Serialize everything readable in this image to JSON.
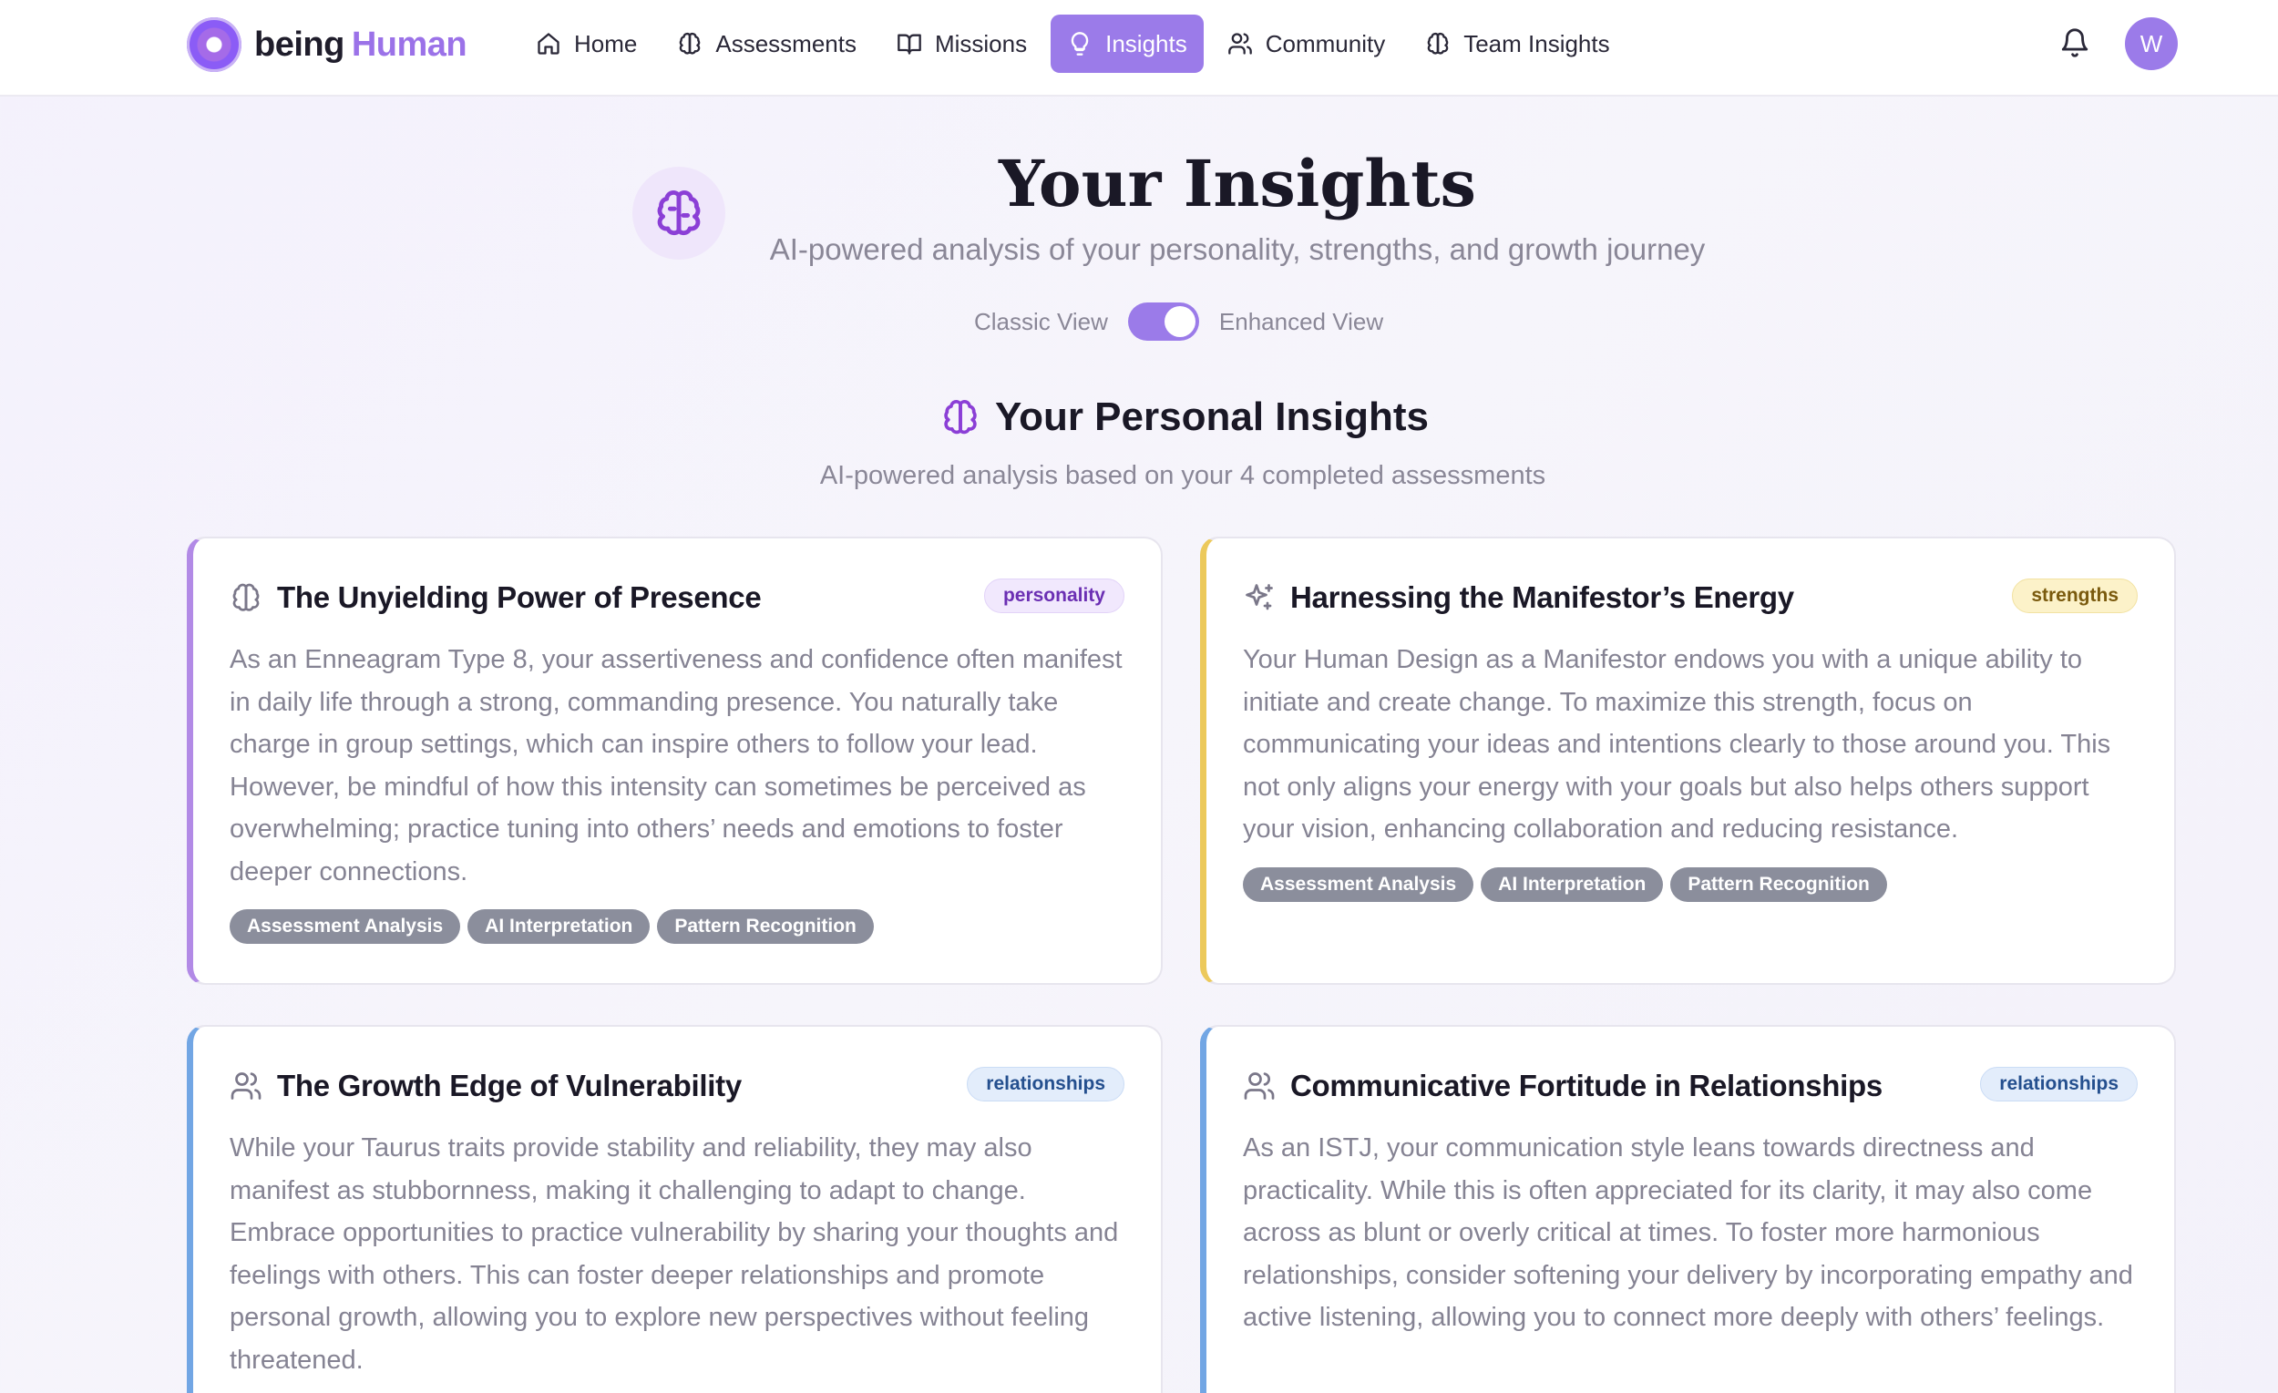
{
  "brand": {
    "word1": "being",
    "word2": "Human"
  },
  "nav": {
    "items": [
      {
        "label": "Home",
        "icon": "home-icon"
      },
      {
        "label": "Assessments",
        "icon": "brain-icon"
      },
      {
        "label": "Missions",
        "icon": "book-icon"
      },
      {
        "label": "Insights",
        "icon": "lightbulb-icon",
        "active": true
      },
      {
        "label": "Community",
        "icon": "users-icon"
      },
      {
        "label": "Team Insights",
        "icon": "brain-icon"
      }
    ],
    "avatar_initial": "W"
  },
  "hero": {
    "title": "Your Insights",
    "subtitle": "AI-powered analysis of your personality, strengths, and growth journey",
    "toggle_left": "Classic View",
    "toggle_right": "Enhanced View",
    "toggle_on": true
  },
  "section": {
    "title": "Your Personal Insights",
    "subtitle": "AI-powered analysis based on your 4 completed assessments"
  },
  "cards": [
    {
      "title": "The Unyielding Power of Presence",
      "category": "personality",
      "icon": "brain-icon",
      "body": "As an Enneagram Type 8, your assertiveness and confidence often manifest in daily life through a strong, commanding presence. You naturally take charge in group settings, which can inspire others to follow your lead. However, be mindful of how this intensity can sometimes be perceived as overwhelming; practice tuning into others’ needs and emotions to foster deeper connections.",
      "tags": [
        "Assessment Analysis",
        "AI Interpretation",
        "Pattern Recognition"
      ]
    },
    {
      "title": "Harnessing the Manifestor’s Energy",
      "category": "strengths",
      "icon": "sparkles-icon",
      "body": "Your Human Design as a Manifestor endows you with a unique ability to initiate and create change. To maximize this strength, focus on communicating your ideas and intentions clearly to those around you. This not only aligns your energy with your goals but also helps others support your vision, enhancing collaboration and reducing resistance.",
      "tags": [
        "Assessment Analysis",
        "AI Interpretation",
        "Pattern Recognition"
      ]
    },
    {
      "title": "The Growth Edge of Vulnerability",
      "category": "relationships",
      "icon": "users-icon",
      "body": "While your Taurus traits provide stability and reliability, they may also manifest as stubbornness, making it challenging to adapt to change. Embrace opportunities to practice vulnerability by sharing your thoughts and feelings with others. This can foster deeper relationships and promote personal growth, allowing you to explore new perspectives without feeling threatened.",
      "tags": []
    },
    {
      "title": "Communicative Fortitude in Relationships",
      "category": "relationships",
      "icon": "users-icon",
      "body": "As an ISTJ, your communication style leans towards directness and practicality. While this is often appreciated for its clarity, it may also come across as blunt or overly critical at times. To foster more harmonious relationships, consider softening your delivery by incorporating empathy and active listening, allowing you to connect more deeply with others’ feelings.",
      "tags": []
    }
  ],
  "colors": {
    "accent": "#9b7be9",
    "personality": "#b28ae6",
    "strengths": "#ecc95b",
    "relationships": "#72a6e4"
  }
}
